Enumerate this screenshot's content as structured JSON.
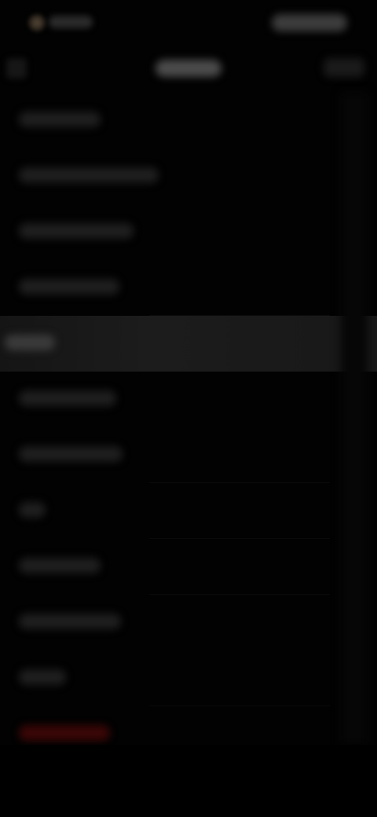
{
  "statusbar": {
    "left_text": "",
    "right_text": ""
  },
  "header": {
    "back_label": "",
    "title": "",
    "action_label": ""
  },
  "list": {
    "items": [
      {
        "label": ""
      },
      {
        "label": ""
      },
      {
        "label": ""
      },
      {
        "label": ""
      },
      {
        "label": ""
      },
      {
        "label": ""
      },
      {
        "label": ""
      },
      {
        "label": ""
      },
      {
        "label": ""
      },
      {
        "label": ""
      },
      {
        "label": ""
      },
      {
        "label": ""
      }
    ],
    "selected_index": 4
  },
  "colors": {
    "background": "#020202",
    "selected_row": "#1c1c1c",
    "danger": "#3a0606"
  },
  "icons": {
    "back": "chevron-left-icon",
    "status": "status-dot-icon"
  }
}
